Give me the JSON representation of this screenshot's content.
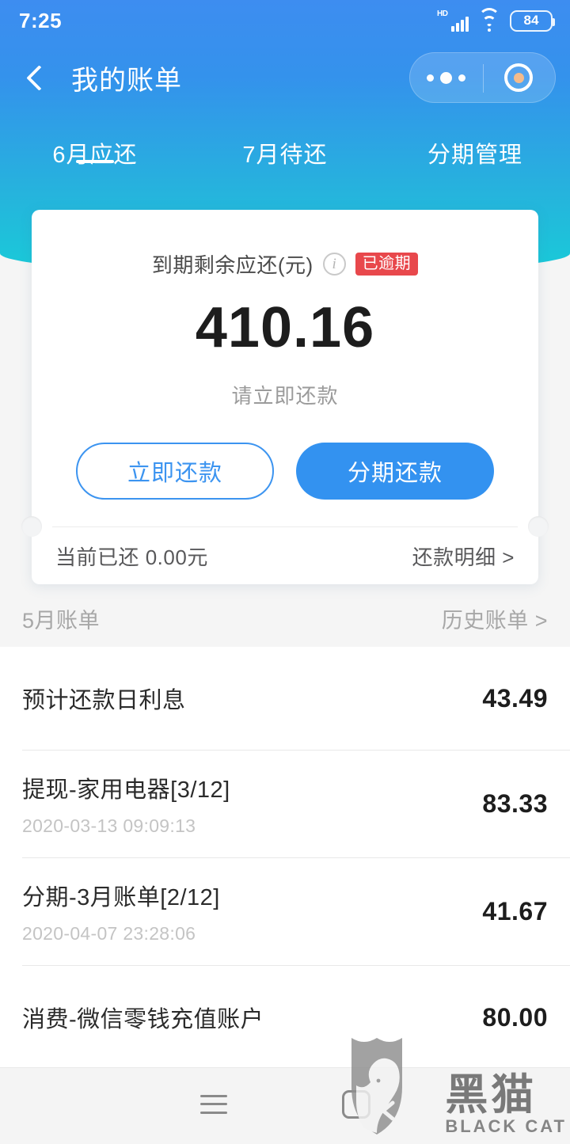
{
  "status_bar": {
    "time": "7:25",
    "network_label": "HD",
    "battery_level": "84",
    "icons": [
      "signal-icon",
      "wifi-icon",
      "battery-icon"
    ]
  },
  "nav": {
    "back_icon": "back-chevron-icon",
    "title": "我的账单",
    "capsule": {
      "more_icon": "more-dots-icon",
      "target_icon": "mini-program-target-icon"
    }
  },
  "tabs": [
    {
      "label": "6月应还",
      "active": true
    },
    {
      "label": "7月待还",
      "active": false
    },
    {
      "label": "分期管理",
      "active": false
    }
  ],
  "summary_card": {
    "amount_label": "到期剩余应还(元)",
    "info_icon": "info-circle-icon",
    "status_badge": "已逾期",
    "amount": "410.16",
    "hint": "请立即还款",
    "primary_button": "分期还款",
    "secondary_button": "立即还款",
    "repaid_text": "当前已还 0.00元",
    "detail_link": "还款明细 >"
  },
  "bill_section": {
    "title": "5月账单",
    "history_link": "历史账单 >"
  },
  "bill_items": [
    {
      "title": "预计还款日利息",
      "date": "",
      "amount": "43.49"
    },
    {
      "title": "提现-家用电器[3/12]",
      "date": "2020-03-13 09:09:13",
      "amount": "83.33"
    },
    {
      "title": "分期-3月账单[2/12]",
      "date": "2020-04-07 23:28:06",
      "amount": "41.67"
    },
    {
      "title": "消费-微信零钱充值账户",
      "date": "",
      "amount": "80.00"
    }
  ],
  "bottom_nav": [
    {
      "icon": "menu-icon"
    },
    {
      "icon": "home-square-icon"
    },
    {
      "icon": "back-icon"
    }
  ],
  "watermark": {
    "cn": "黑猫",
    "en": "BLACK CAT",
    "shield_icon": "black-cat-shield-icon"
  },
  "colors": {
    "header_top": "#3d8df0",
    "header_bottom": "#19cbd8",
    "accent_blue": "#3392f0",
    "badge_red": "#e8484c",
    "page_bg": "#f5f5f5"
  }
}
